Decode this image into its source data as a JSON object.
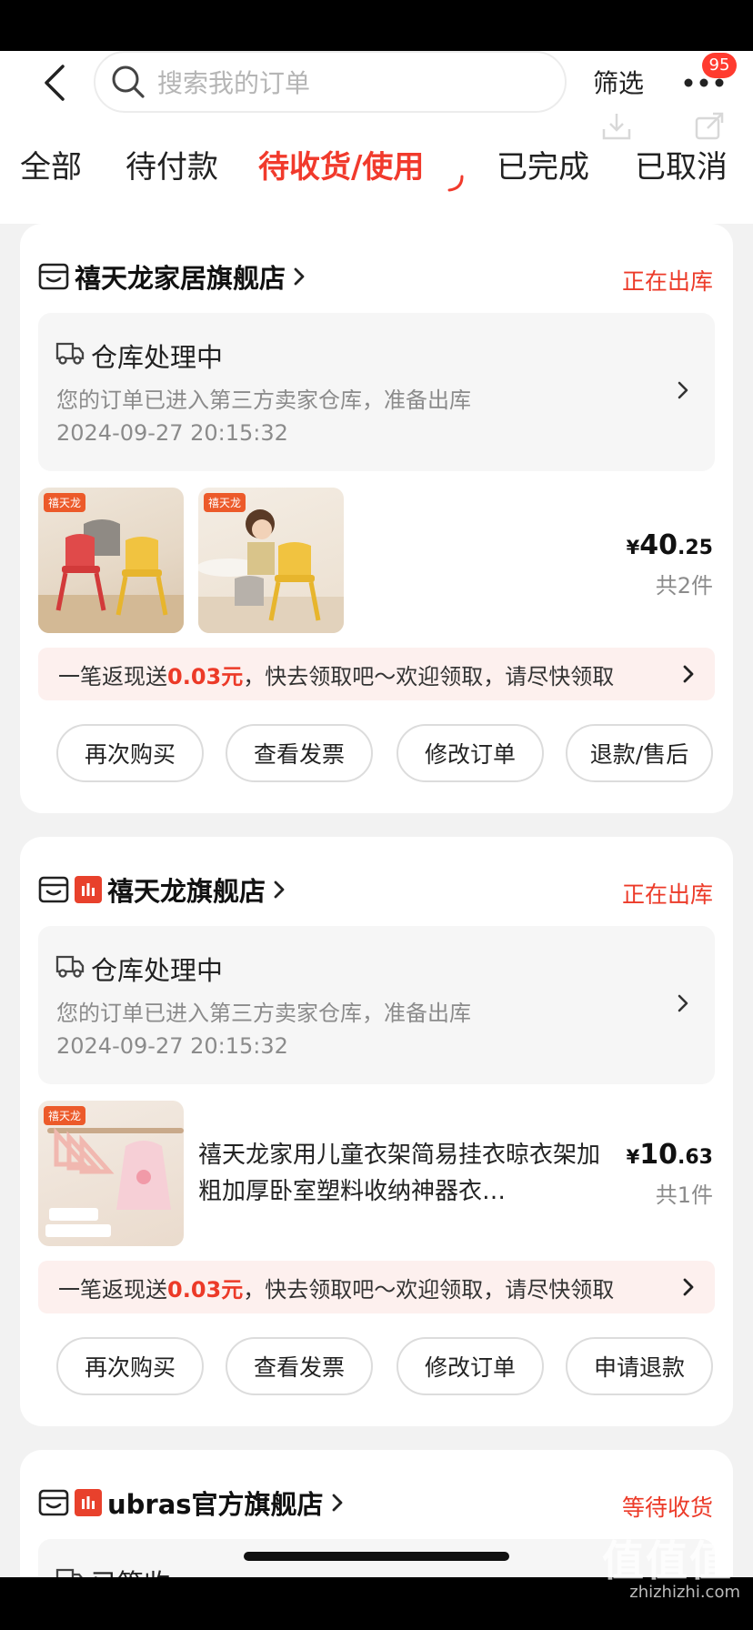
{
  "header": {
    "search_placeholder": "搜索我的订单",
    "filter_label": "筛选",
    "more_badge": "95"
  },
  "tabs": [
    {
      "label": "全部"
    },
    {
      "label": "待付款"
    },
    {
      "label": "待收货/使用"
    },
    {
      "label": "已完成"
    },
    {
      "label": "已取消"
    }
  ],
  "orders": [
    {
      "shop_name": "禧天龙家居旗舰店",
      "status": "正在出库",
      "logistics": {
        "title": "仓库处理中",
        "desc": "您的订单已进入第三方卖家仓库，准备出库",
        "time": "2024-09-27 20:15:32"
      },
      "thumb_tags": [
        "禧天龙",
        "禧天龙"
      ],
      "price_symbol": "¥",
      "price_int": "40",
      "price_dec": ".25",
      "count": "共2件",
      "cashback": {
        "prefix": "一笔返现送",
        "amount": "0.03元",
        "suffix": "，快去领取吧～欢迎领取，请尽快领取"
      },
      "buttons": [
        "再次购买",
        "查看发票",
        "修改订单",
        "退款/售后"
      ]
    },
    {
      "shop_name": "禧天龙旗舰店",
      "status": "正在出库",
      "logistics": {
        "title": "仓库处理中",
        "desc": "您的订单已进入第三方卖家仓库，准备出库",
        "time": "2024-09-27 20:15:32"
      },
      "thumb_tags": [
        "禧天龙"
      ],
      "product_title": "禧天龙家用儿童衣架简易挂衣晾衣架加粗加厚卧室塑料收纳神器衣…",
      "price_symbol": "¥",
      "price_int": "10",
      "price_dec": ".63",
      "count": "共1件",
      "cashback": {
        "prefix": "一笔返现送",
        "amount": "0.03元",
        "suffix": "，快去领取吧～欢迎领取，请尽快领取"
      },
      "buttons": [
        "再次购买",
        "查看发票",
        "修改订单",
        "申请退款"
      ]
    },
    {
      "shop_name": "ubras官方旗舰店",
      "status": "等待收货",
      "logistics": {
        "title": "已签收"
      }
    }
  ],
  "watermark": {
    "big": "值值值",
    "url": "zhizhizhi.com"
  }
}
